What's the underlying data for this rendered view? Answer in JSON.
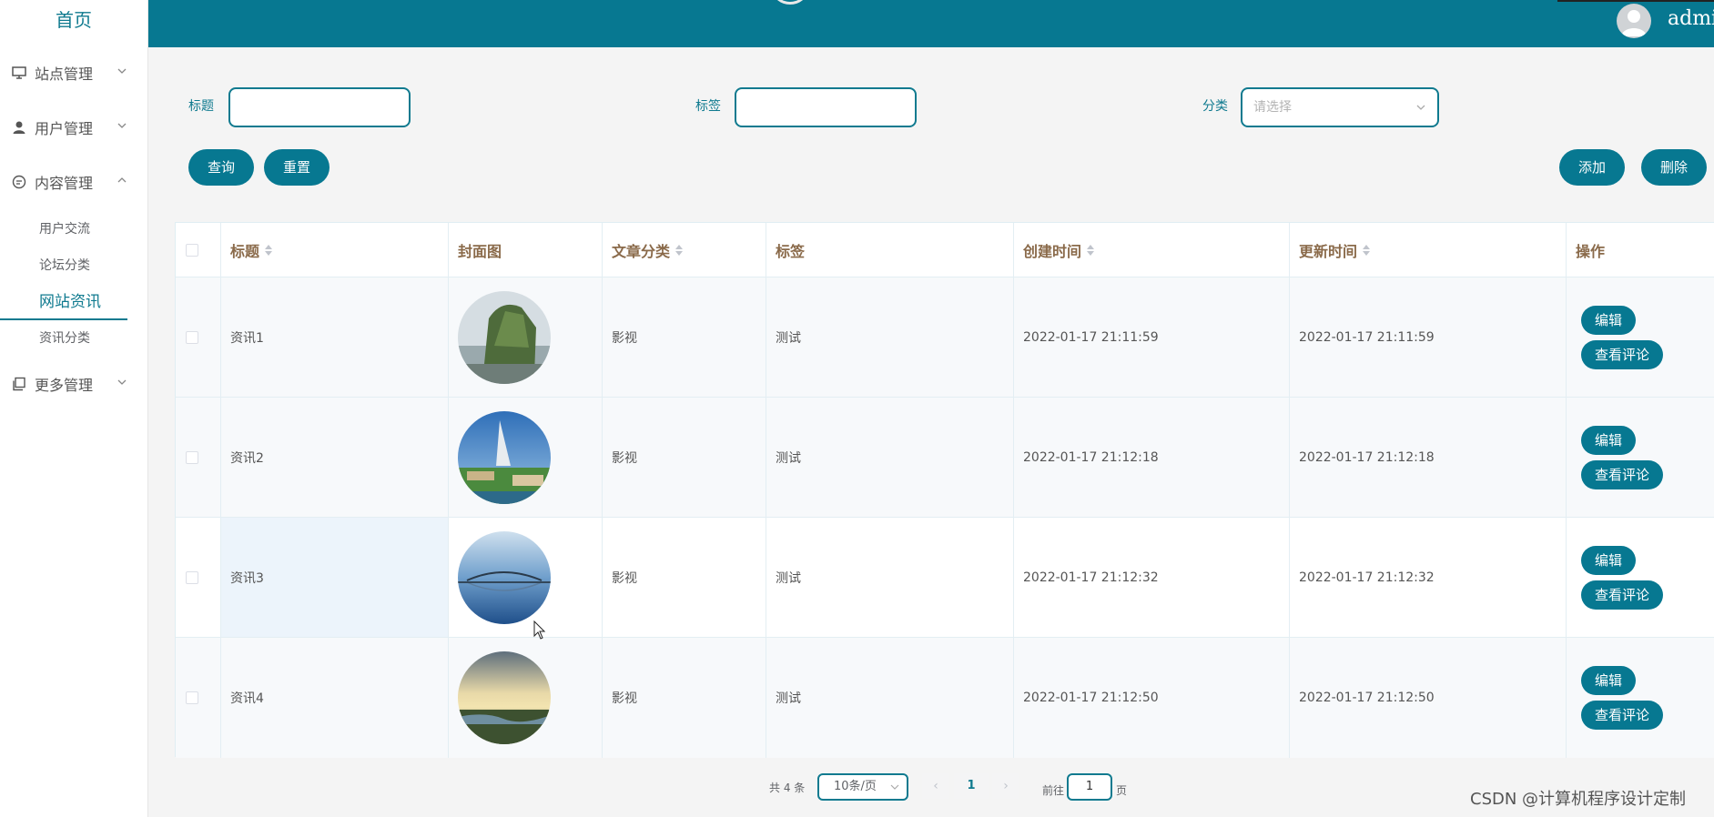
{
  "sidebar": {
    "home": "首页",
    "menus": [
      {
        "label": "站点管理",
        "icon": "monitor-icon",
        "expanded": false
      },
      {
        "label": "用户管理",
        "icon": "user-icon",
        "expanded": false
      },
      {
        "label": "内容管理",
        "icon": "chat-icon",
        "expanded": true
      },
      {
        "label": "更多管理",
        "icon": "copy-icon",
        "expanded": false
      }
    ],
    "submenu": [
      {
        "label": "用户交流"
      },
      {
        "label": "论坛分类"
      },
      {
        "label": "网站资讯",
        "active": true
      },
      {
        "label": "资讯分类"
      }
    ]
  },
  "header": {
    "username": "admin"
  },
  "search": {
    "title_label": "标题",
    "tag_label": "标签",
    "category_label": "分类",
    "category_placeholder": "请选择",
    "query_button": "查询",
    "reset_button": "重置",
    "add_button": "添加",
    "delete_button": "删除"
  },
  "table": {
    "columns": [
      "标题",
      "封面图",
      "文章分类",
      "标签",
      "创建时间",
      "更新时间",
      "操作"
    ],
    "edit_label": "编辑",
    "comments_label": "查看评论",
    "rows": [
      {
        "title": "资讯1",
        "category": "影视",
        "tag": "测试",
        "created": "2022-01-17 21:11:59",
        "updated": "2022-01-17 21:11:59",
        "cover": "cliff-lake-photo"
      },
      {
        "title": "资讯2",
        "category": "影视",
        "tag": "测试",
        "created": "2022-01-17 21:12:18",
        "updated": "2022-01-17 21:12:18",
        "cover": "dubai-hotel-photo"
      },
      {
        "title": "资讯3",
        "category": "影视",
        "tag": "测试",
        "created": "2022-01-17 21:12:32",
        "updated": "2022-01-17 21:12:32",
        "cover": "bridge-sea-photo"
      },
      {
        "title": "资讯4",
        "category": "影视",
        "tag": "测试",
        "created": "2022-01-17 21:12:50",
        "updated": "2022-01-17 21:12:50",
        "cover": "sunset-wetland-photo"
      }
    ]
  },
  "pagination": {
    "total": "共 4 条",
    "page_size": "10条/页",
    "current_page": "1",
    "goto_prefix": "前往",
    "goto_value": "1",
    "goto_suffix": "页"
  },
  "watermark": "CSDN @计算机程序设计定制",
  "colors": {
    "primary": "#077891",
    "header": "#077891"
  }
}
